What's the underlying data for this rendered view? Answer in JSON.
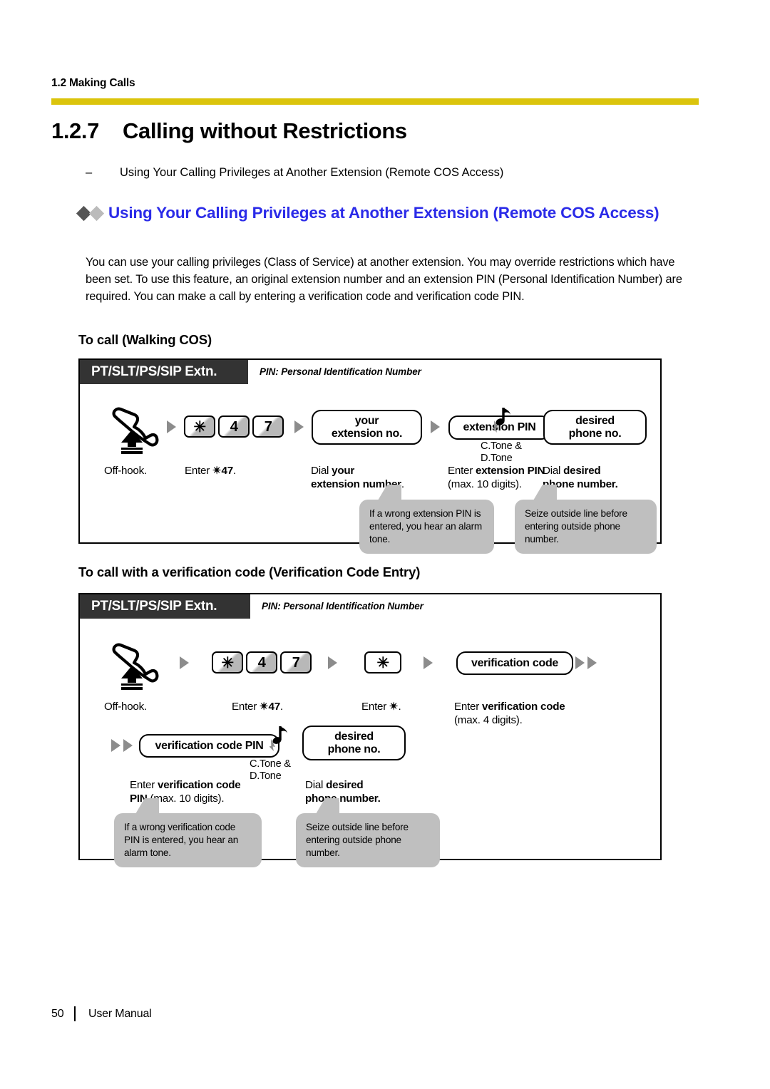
{
  "header": {
    "running_head": "1.2 Making Calls",
    "rule_color": "#dbc40c"
  },
  "section": {
    "number": "1.2.7",
    "title": "Calling without Restrictions",
    "feature_dash": "–",
    "feature_item": "Using Your Calling Privileges at Another Extension (Remote COS Access)"
  },
  "feature": {
    "heading": "Using Your Calling Privileges at Another Extension (Remote COS Access)",
    "heading_color": "#2b2be8",
    "bullet_color_1": "#555555",
    "bullet_color_2": "#bbbbbb",
    "description": "You can use your calling privileges (Class of Service) at another extension. You may override restrictions which have been set. To use this feature, an original extension number and an extension PIN (Personal Identification Number) are required. You can make a call by entering a verification code and verification code PIN."
  },
  "procedure_1": {
    "sub_heading": "To call (Walking COS)",
    "phone_types": "PT/SLT/PS/SIP Extn.",
    "pin_note": "PIN: Personal Identification Number",
    "steps": {
      "offhook_icon": "off-hook-handset-icon",
      "offhook_caption": "Off-hook.",
      "keys": [
        "✳",
        "4",
        "7"
      ],
      "keys_caption_prefix": "Enter ",
      "keys_caption_code": "✴47",
      "keys_caption_suffix": ".",
      "ext_no_line1": "your",
      "ext_no_line2": "extension no.",
      "ext_no_caption_1": "Dial ",
      "ext_no_caption_2": "your",
      "ext_no_caption_3": "extension number",
      "ext_no_caption_4": ".",
      "ext_pin_label": "extension PIN",
      "ext_pin_caption_1": "Enter ",
      "ext_pin_caption_2": "extension PIN",
      "ext_pin_caption_3": "(max. 10 digits).",
      "tone_line1": "C.Tone &",
      "tone_line2": "D.Tone",
      "tone_icon": "music-note-tone-icon",
      "desired_line1": "desired",
      "desired_line2": "phone no.",
      "desired_caption_1": "Dial ",
      "desired_caption_2": "desired",
      "desired_caption_3": "phone number."
    },
    "callouts": [
      "If a wrong extension PIN is entered, you hear an alarm tone.",
      "Seize outside line before entering outside phone number."
    ]
  },
  "procedure_2": {
    "sub_heading": "To call with a verification code (Verification Code Entry)",
    "phone_types": "PT/SLT/PS/SIP Extn.",
    "pin_note": "PIN: Personal Identification Number",
    "steps": {
      "offhook_icon": "off-hook-handset-icon",
      "offhook_caption": "Off-hook.",
      "keys": [
        "✳",
        "4",
        "7"
      ],
      "keys_caption_prefix": "Enter ",
      "keys_caption_code": "✴47",
      "keys_caption_suffix": ".",
      "star_key": "✳",
      "star_caption_1": "Enter ",
      "star_caption_2": "✴",
      "star_caption_3": ".",
      "vcode_label": "verification code",
      "vcode_caption_1": "Enter ",
      "vcode_caption_2": "verification code",
      "vcode_caption_3": "(max. 4 digits).",
      "vpin_label": "verification code PIN",
      "vpin_caption_1": "Enter ",
      "vpin_caption_2": "verification code",
      "vpin_caption_3": "PIN",
      "vpin_caption_4": " (max. 10 digits).",
      "tone_line1": "C.Tone &",
      "tone_line2": "D.Tone",
      "tone_icon": "music-note-tone-icon",
      "desired_line1": "desired",
      "desired_line2": "phone no.",
      "desired_caption_1": "Dial ",
      "desired_caption_2": "desired",
      "desired_caption_3": "phone number."
    },
    "callouts": [
      "If a wrong verification code PIN is entered, you hear an alarm tone.",
      "Seize outside line before entering outside phone number."
    ]
  },
  "footer": {
    "page_number": "50",
    "doc_title": "User Manual"
  }
}
